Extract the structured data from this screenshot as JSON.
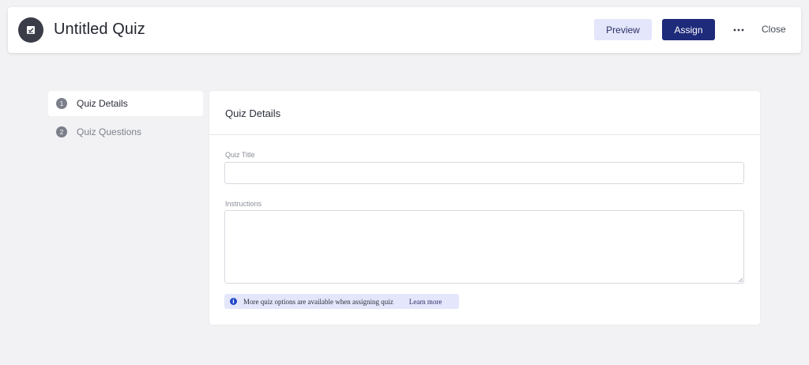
{
  "header": {
    "title": "Untitled Quiz",
    "icon": "quiz-checkbox-icon",
    "preview_label": "Preview",
    "assign_label": "Assign",
    "more_icon": "more-horizontal-icon",
    "close_label": "Close"
  },
  "steps": [
    {
      "number": "1",
      "label": "Quiz Details",
      "active": true
    },
    {
      "number": "2",
      "label": "Quiz Questions",
      "active": false
    }
  ],
  "card": {
    "title": "Quiz Details",
    "quiz_title_label": "Quiz Title",
    "quiz_title_value": "",
    "instructions_label": "Instructions",
    "instructions_value": ""
  },
  "info": {
    "icon": "info-icon",
    "text": "More quiz options are available when assigning quiz",
    "link": "Learn more"
  },
  "colors": {
    "accent": "#1e2a7a",
    "accent_light": "#e4e6fb",
    "background": "#f2f2f4",
    "info_icon": "#1f47c9"
  }
}
